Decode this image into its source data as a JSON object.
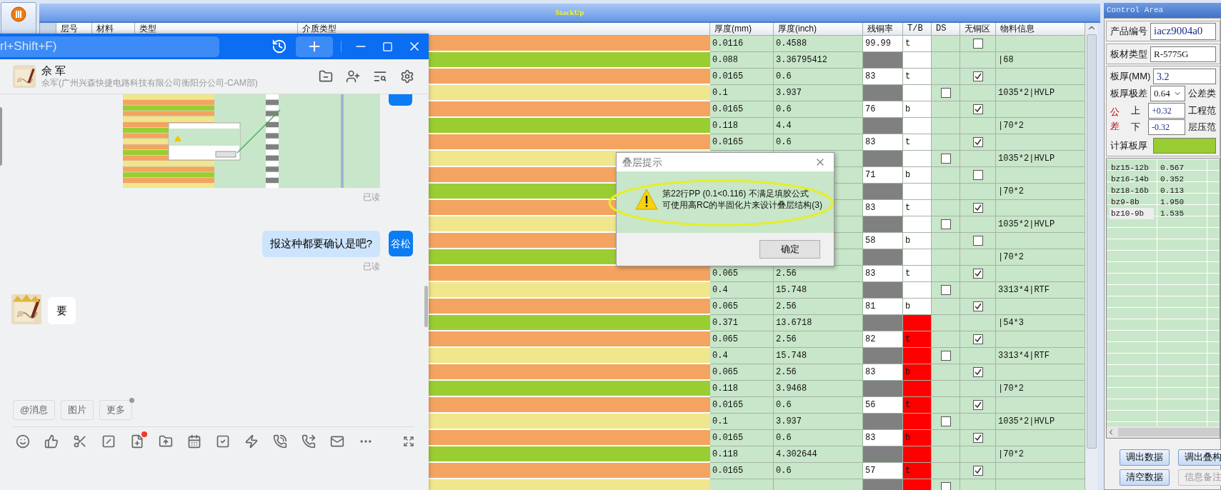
{
  "stackup": {
    "title": "StackUp",
    "columns": [
      "层号",
      "材料",
      "类型",
      "介质类型",
      "厚度(mm)",
      "厚度(inch)",
      "残铜率",
      "T/B",
      "DS",
      "无铜区",
      "物料信息"
    ],
    "rows": [
      {
        "kind": "copper",
        "color": "#f4a460",
        "thickness_mm": "0.0116",
        "thickness_inch": "0.4588",
        "copper_rate": "99.99",
        "tb": "t",
        "tb_flag": false,
        "no_copper_area": false
      },
      {
        "kind": "core",
        "color": "#9acd32",
        "thickness_mm": "0.088",
        "thickness_inch": "3.36795412",
        "tb_flag": false,
        "material_info": "|68"
      },
      {
        "kind": "copper",
        "color": "#f4a460",
        "thickness_mm": "0.0165",
        "thickness_inch": "0.6",
        "copper_rate": "83",
        "tb": "t",
        "tb_flag": false,
        "no_copper_area": true
      },
      {
        "kind": "prepreg",
        "color": "#f0e68c",
        "thickness_mm": "0.1",
        "thickness_inch": "3.937",
        "tb_flag": false,
        "ds": false,
        "material_info": "1035*2|HVLP"
      },
      {
        "kind": "copper",
        "color": "#f4a460",
        "thickness_mm": "0.0165",
        "thickness_inch": "0.6",
        "copper_rate": "76",
        "tb": "b",
        "tb_flag": false,
        "no_copper_area": true
      },
      {
        "kind": "core",
        "color": "#9acd32",
        "thickness_mm": "0.118",
        "thickness_inch": "4.4",
        "tb_flag": false,
        "material_info": "|70*2"
      },
      {
        "kind": "copper",
        "color": "#f4a460",
        "thickness_mm": "0.0165",
        "thickness_inch": "0.6",
        "copper_rate": "83",
        "tb": "t",
        "tb_flag": false,
        "no_copper_area": true
      },
      {
        "kind": "prepreg",
        "color": "#f0e68c",
        "tb_flag": false,
        "ds": false,
        "material_info": "1035*2|HVLP"
      },
      {
        "kind": "copper",
        "color": "#f4a460",
        "copper_rate": "71",
        "tb": "b",
        "tb_flag": false,
        "no_copper_area": false
      },
      {
        "kind": "core",
        "color": "#9acd32",
        "tb_flag": false,
        "material_info": "|70*2"
      },
      {
        "kind": "copper",
        "color": "#f4a460",
        "copper_rate": "83",
        "tb": "t",
        "tb_flag": false,
        "no_copper_area": true
      },
      {
        "kind": "prepreg",
        "color": "#f0e68c",
        "tb_flag": false,
        "ds": false,
        "material_info": "1035*2|HVLP"
      },
      {
        "kind": "copper",
        "color": "#f4a460",
        "copper_rate": "58",
        "tb": "b",
        "tb_flag": false,
        "no_copper_area": false
      },
      {
        "kind": "core",
        "color": "#9acd32",
        "tb_flag": false,
        "material_info": "|70*2"
      },
      {
        "kind": "copper",
        "color": "#f4a460",
        "thickness_mm": "0.065",
        "thickness_inch": "2.56",
        "copper_rate": "83",
        "tb": "t",
        "tb_flag": false,
        "no_copper_area": true
      },
      {
        "kind": "prepreg",
        "color": "#f0e68c",
        "thickness_mm": "0.4",
        "thickness_inch": "15.748",
        "tb_flag": false,
        "ds": false,
        "material_info": "3313*4|RTF"
      },
      {
        "kind": "copper",
        "color": "#f4a460",
        "thickness_mm": "0.065",
        "thickness_inch": "2.56",
        "copper_rate": "81",
        "tb": "b",
        "tb_flag": false,
        "no_copper_area": true
      },
      {
        "kind": "core",
        "color": "#9acd32",
        "thickness_mm": "0.371",
        "thickness_inch": "13.6718",
        "tb_flag": true,
        "material_info": "|54*3"
      },
      {
        "kind": "copper",
        "color": "#f4a460",
        "thickness_mm": "0.065",
        "thickness_inch": "2.56",
        "copper_rate": "82",
        "tb": "t",
        "tb_flag": true,
        "no_copper_area": true
      },
      {
        "kind": "prepreg",
        "color": "#f0e68c",
        "thickness_mm": "0.4",
        "thickness_inch": "15.748",
        "tb_flag": true,
        "ds": false,
        "material_info": "3313*4|RTF"
      },
      {
        "kind": "copper",
        "color": "#f4a460",
        "thickness_mm": "0.065",
        "thickness_inch": "2.56",
        "copper_rate": "83",
        "tb": "b",
        "tb_flag": true,
        "no_copper_area": true
      },
      {
        "kind": "core",
        "color": "#9acd32",
        "thickness_mm": "0.118",
        "thickness_inch": "3.9468",
        "tb_flag": true,
        "material_info": "|70*2"
      },
      {
        "kind": "copper",
        "color": "#f4a460",
        "thickness_mm": "0.0165",
        "thickness_inch": "0.6",
        "copper_rate": "56",
        "tb": "t",
        "tb_flag": true,
        "no_copper_area": true
      },
      {
        "kind": "prepreg",
        "color": "#f0e68c",
        "thickness_mm": "0.1",
        "thickness_inch": "3.937",
        "tb_flag": true,
        "ds": false,
        "material_info": "1035*2|HVLP"
      },
      {
        "kind": "copper",
        "color": "#f4a460",
        "thickness_mm": "0.0165",
        "thickness_inch": "0.6",
        "copper_rate": "83",
        "tb": "b",
        "tb_flag": true,
        "no_copper_area": true
      },
      {
        "kind": "core",
        "color": "#9acd32",
        "thickness_mm": "0.118",
        "thickness_inch": "4.302644",
        "tb_flag": true,
        "material_info": "|70*2"
      },
      {
        "kind": "copper",
        "color": "#f4a460",
        "thickness_mm": "0.0165",
        "thickness_inch": "0.6",
        "copper_rate": "57",
        "tb": "t",
        "tb_flag": true,
        "no_copper_area": true
      },
      {
        "kind": "prepreg",
        "color": "#f0e68c",
        "tb_flag": true,
        "ds": false
      }
    ]
  },
  "chat": {
    "search_placeholder": "rl+Shift+F)",
    "contact": {
      "name": "佘 军",
      "subtitle": "佘军(广州兴森快捷电路科技有限公司衡阳分公司-CAM部)"
    },
    "messages": [
      {
        "kind": "sent_image",
        "status": "已读"
      },
      {
        "kind": "sent_text",
        "text": "报这种都要确认是吧?",
        "avatar": "谷松",
        "status": "已读"
      },
      {
        "kind": "received_text",
        "text": "要"
      }
    ],
    "quick_actions": [
      "@消息",
      "图片",
      "更多"
    ]
  },
  "dialog": {
    "title": "叠层提示",
    "lines": [
      "第22行PP (0.1<0.116) 不满足填胶公式",
      "可使用高RC的半固化片来设计叠层结构(3)"
    ],
    "button": "确定"
  },
  "control": {
    "title": "Control Area",
    "product_no_label": "产品编号",
    "product_no": "iacz9004a0",
    "material_label": "板材类型",
    "material": "R-5775G",
    "thickness_label": "板厚(MM)",
    "thickness": "3.2",
    "range_label": "板厚极差",
    "range": "0.64",
    "tolerance_type_label": "公差类",
    "tolerance_label": "公差",
    "upper_label": "上",
    "upper": "+0.32",
    "eng_range_label": "工程范",
    "lower_label": "下",
    "lower": "-0.32",
    "press_range_label": "层压范",
    "calc_label": "计算板厚",
    "results": [
      {
        "name": "bz15-12b",
        "value": "0.567",
        "selected": false
      },
      {
        "name": "bz16-14b",
        "value": "0.352",
        "selected": false
      },
      {
        "name": "bz18-16b",
        "value": "0.113",
        "selected": false
      },
      {
        "name": "bz9-8b",
        "value": "1.950",
        "selected": false
      },
      {
        "name": "bz10-9b",
        "value": "1.535",
        "selected": true
      }
    ],
    "buttons": [
      {
        "label": "调出数据",
        "disabled": false
      },
      {
        "label": "调出叠构",
        "disabled": false
      },
      {
        "label": "清空数据",
        "disabled": false
      },
      {
        "label": "信息备注",
        "disabled": true
      }
    ]
  }
}
